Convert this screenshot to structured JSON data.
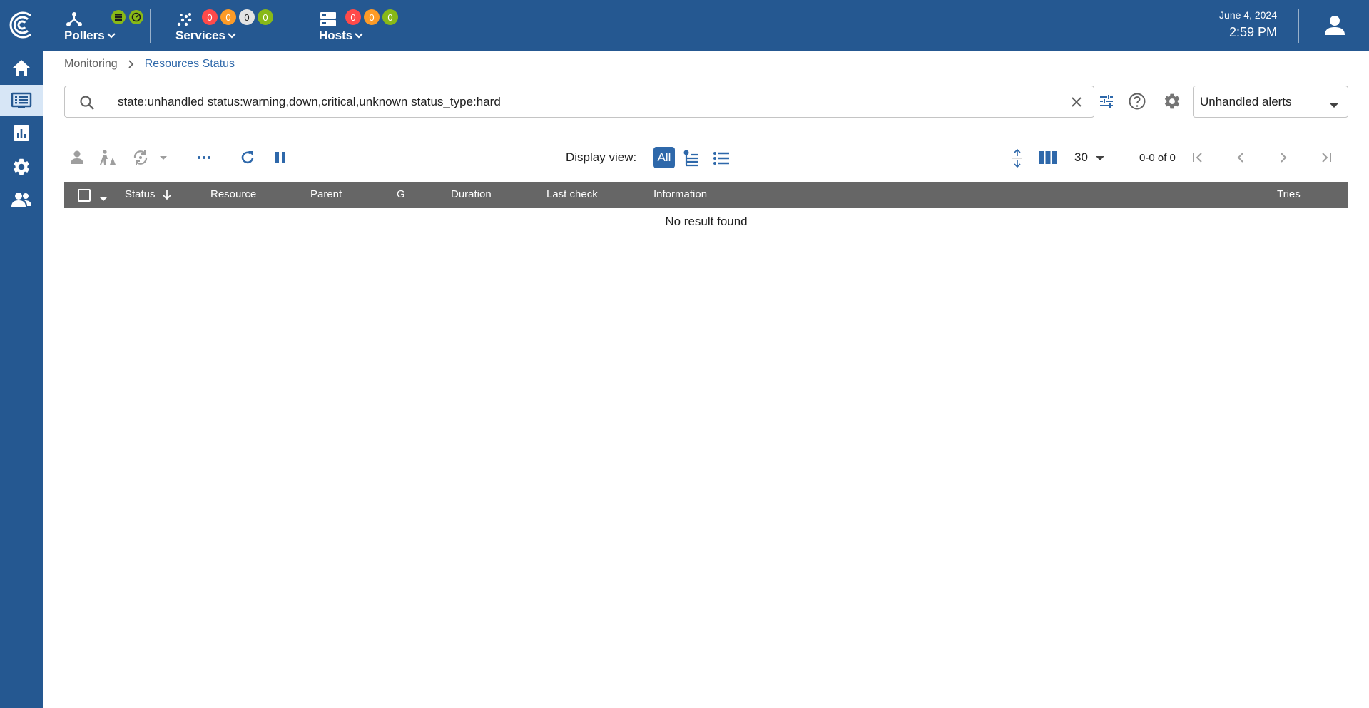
{
  "topbar": {
    "pollers": {
      "label": "Pollers"
    },
    "services": {
      "label": "Services",
      "counts": [
        "0",
        "0",
        "0",
        "0"
      ]
    },
    "hosts": {
      "label": "Hosts",
      "counts": [
        "0",
        "0",
        "0"
      ]
    },
    "date": "June 4, 2024",
    "time": "2:59 PM"
  },
  "colors": {
    "header": "#255891",
    "critical": "#ff4a4a",
    "warning": "#fd9b27",
    "unknown": "#e3e3e3",
    "ok": "#88b917",
    "accent": "#2e68aa"
  },
  "breadcrumb": {
    "parent": "Monitoring",
    "current": "Resources Status"
  },
  "search": {
    "query": "state:unhandled status:warning,down,critical,unknown status_type:hard"
  },
  "filter": {
    "selected": "Unhandled alerts"
  },
  "toolbar": {
    "display_view_label": "Display view:",
    "view_all": "All",
    "per_page": "30",
    "pagination": "0-0 of 0"
  },
  "table": {
    "columns": {
      "status": "Status",
      "resource": "Resource",
      "parent": "Parent",
      "g": "G",
      "duration": "Duration",
      "last_check": "Last check",
      "information": "Information",
      "tries": "Tries"
    },
    "empty_message": "No result found"
  }
}
